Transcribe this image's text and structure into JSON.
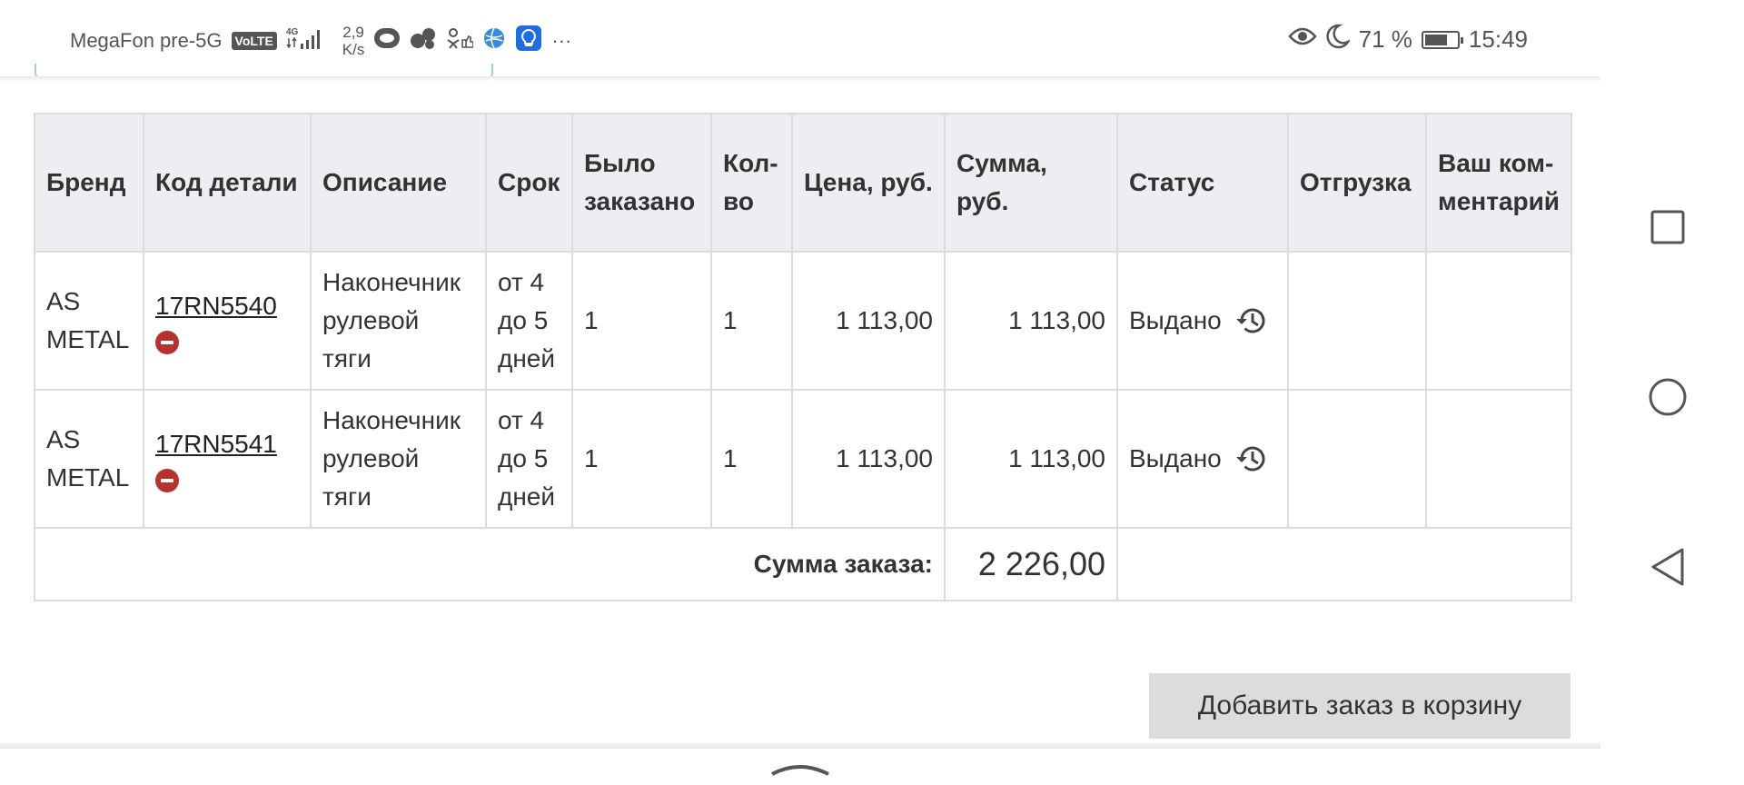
{
  "status_bar": {
    "carrier": "MegaFon pre-5G",
    "volte": "VoLTE",
    "network": "4G",
    "speed_value": "2,9",
    "speed_unit": "K/s",
    "more": "···",
    "battery_percent": "71 %",
    "battery_level": 0.71,
    "time": "15:49"
  },
  "table": {
    "headers": {
      "brand": "Бренд",
      "code": "Код детали",
      "description": "Описание",
      "term": "Срок",
      "ordered_1": "Было",
      "ordered_2": "заказано",
      "qty_1": "Кол-",
      "qty_2": "во",
      "price": "Цена, руб.",
      "sum": "Сумма, руб.",
      "status": "Статус",
      "shipment": "Отгрузка",
      "comment_1": "Ваш ком-",
      "comment_2": "ментарий"
    },
    "rows": [
      {
        "brand_1": "AS",
        "brand_2": "METAL",
        "code": "17RN5540",
        "desc_1": "Наконечник",
        "desc_2": "рулевой",
        "desc_3": "тяги",
        "term_1": "от 4",
        "term_2": "до 5",
        "term_3": "дней",
        "ordered": "1",
        "qty": "1",
        "price": "1 113,00",
        "sum": "1 113,00",
        "status": "Выдано",
        "shipment": "",
        "comment": ""
      },
      {
        "brand_1": "AS",
        "brand_2": "METAL",
        "code": "17RN5541",
        "desc_1": "Наконечник",
        "desc_2": "рулевой",
        "desc_3": "тяги",
        "term_1": "от 4",
        "term_2": "до 5",
        "term_3": "дней",
        "ordered": "1",
        "qty": "1",
        "price": "1 113,00",
        "sum": "1 113,00",
        "status": "Выдано",
        "shipment": "",
        "comment": ""
      }
    ],
    "total_label": "Сумма заказа:",
    "total_value": "2 226,00"
  },
  "actions": {
    "add_to_cart": "Добавить заказ в корзину"
  },
  "colors": {
    "header_bg": "#eceef1",
    "remove_icon": "#b6322e",
    "button_bg": "#dcdcdc"
  }
}
